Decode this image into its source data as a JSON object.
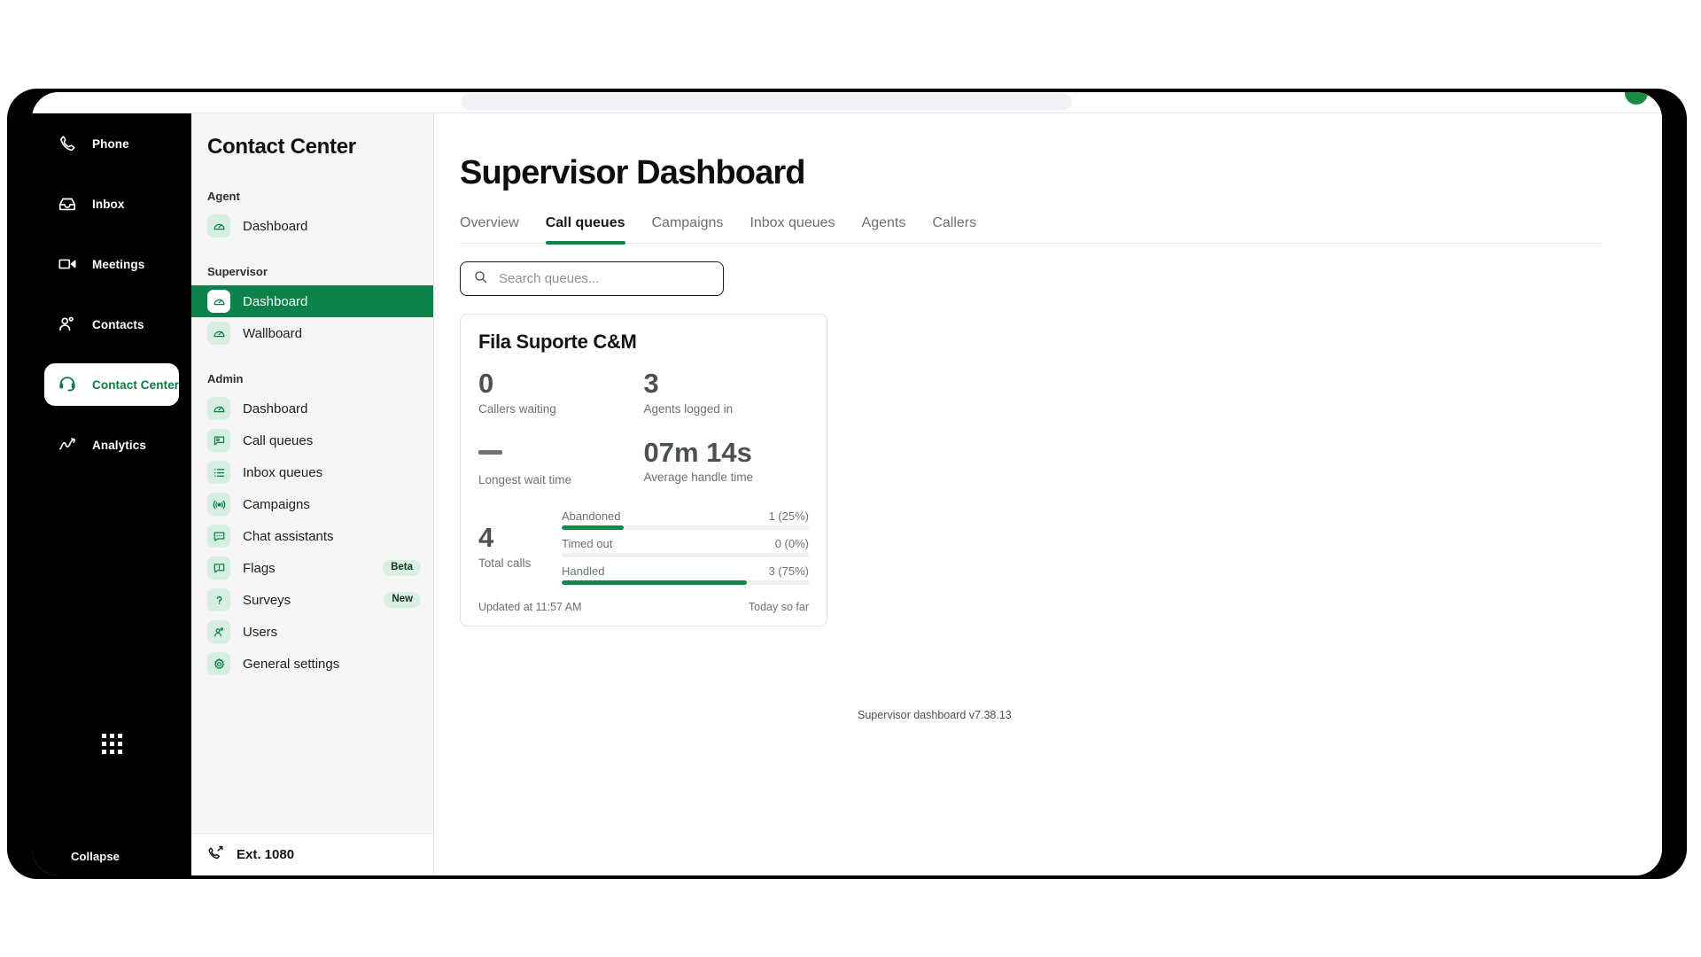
{
  "rail": {
    "items": [
      {
        "label": "Phone",
        "icon": "phone-icon",
        "active": false
      },
      {
        "label": "Inbox",
        "icon": "inbox-icon",
        "active": false
      },
      {
        "label": "Meetings",
        "icon": "video-camera-icon",
        "active": false
      },
      {
        "label": "Contacts",
        "icon": "contacts-icon",
        "active": false
      },
      {
        "label": "Contact Center",
        "icon": "headset-icon",
        "active": true
      },
      {
        "label": "Analytics",
        "icon": "analytics-chart-icon",
        "active": false
      }
    ],
    "apps_icon": "app-grid-icon",
    "collapse_label": "Collapse",
    "collapse_icon": "chevron-left-icon"
  },
  "subnav": {
    "title": "Contact Center",
    "groups": [
      {
        "label": "Agent",
        "items": [
          {
            "label": "Dashboard",
            "icon": "gauge-icon",
            "active": false,
            "badge": ""
          }
        ]
      },
      {
        "label": "Supervisor",
        "items": [
          {
            "label": "Dashboard",
            "icon": "gauge-icon",
            "active": true,
            "badge": ""
          },
          {
            "label": "Wallboard",
            "icon": "gauge-icon",
            "active": false,
            "badge": ""
          }
        ]
      },
      {
        "label": "Admin",
        "items": [
          {
            "label": "Dashboard",
            "icon": "gauge-icon",
            "active": false,
            "badge": ""
          },
          {
            "label": "Call queues",
            "icon": "call-queue-icon",
            "active": false,
            "badge": ""
          },
          {
            "label": "Inbox queues",
            "icon": "list-icon",
            "active": false,
            "badge": ""
          },
          {
            "label": "Campaigns",
            "icon": "broadcast-icon",
            "active": false,
            "badge": ""
          },
          {
            "label": "Chat assistants",
            "icon": "chat-bubble-icon",
            "active": false,
            "badge": ""
          },
          {
            "label": "Flags",
            "icon": "flag-alert-icon",
            "active": false,
            "badge": "Beta"
          },
          {
            "label": "Surveys",
            "icon": "question-mark-icon",
            "active": false,
            "badge": "New"
          },
          {
            "label": "Users",
            "icon": "users-icon",
            "active": false,
            "badge": ""
          },
          {
            "label": "General settings",
            "icon": "gear-icon",
            "active": false,
            "badge": ""
          }
        ]
      }
    ],
    "footer": {
      "icon": "phone-forward-icon",
      "label": "Ext. 1080"
    }
  },
  "main": {
    "page_title": "Supervisor Dashboard",
    "tabs": [
      {
        "label": "Overview",
        "active": false
      },
      {
        "label": "Call queues",
        "active": true
      },
      {
        "label": "Campaigns",
        "active": false
      },
      {
        "label": "Inbox queues",
        "active": false
      },
      {
        "label": "Agents",
        "active": false
      },
      {
        "label": "Callers",
        "active": false
      }
    ],
    "search": {
      "icon": "search-icon",
      "placeholder": "Search queues...",
      "value": ""
    },
    "version_note": "Supervisor dashboard v7.38.13"
  },
  "queue_card": {
    "name": "Fila Suporte C&M",
    "kpis": [
      {
        "value": "0",
        "label": "Callers waiting",
        "dash": false
      },
      {
        "value": "3",
        "label": "Agents logged in",
        "dash": false
      },
      {
        "value": "—",
        "label": "Longest wait time",
        "dash": true
      },
      {
        "value": "07m 14s",
        "label": "Average handle time",
        "dash": false
      }
    ],
    "total_calls": {
      "value": "4",
      "label": "Total calls"
    },
    "breakdown": [
      {
        "label": "Abandoned",
        "display": "1 (25%)",
        "count": 1,
        "percent": 25
      },
      {
        "label": "Timed out",
        "display": "0 (0%)",
        "count": 0,
        "percent": 0
      },
      {
        "label": "Handled",
        "display": "3 (75%)",
        "count": 3,
        "percent": 75
      }
    ],
    "footer_left": "Updated at 11:57 AM",
    "footer_right": "Today so far"
  },
  "colors": {
    "brand_green": "#0b8249",
    "bar_green": "#0f8a48",
    "rail_bg": "#000000",
    "subnav_bg": "#f5f6f5",
    "icon_tile": "#d6efe0"
  }
}
